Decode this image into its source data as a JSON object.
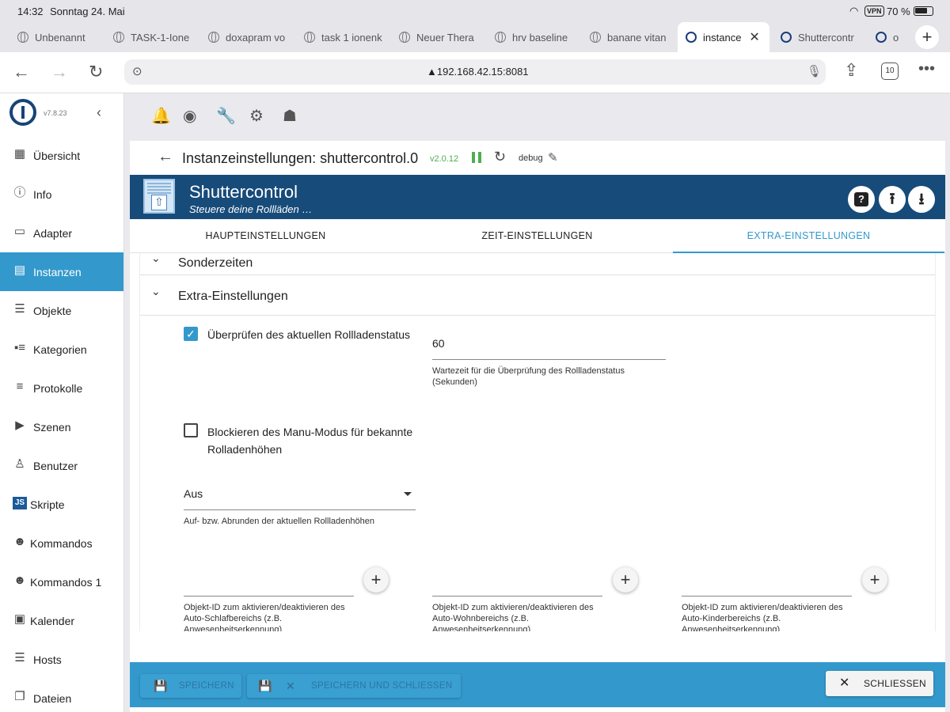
{
  "status_bar": {
    "time": "14:32",
    "date": "Sonntag 24. Mai",
    "vpn": "VPN",
    "battery": "70 %"
  },
  "browser_tabs": [
    {
      "label": "Unbenannt"
    },
    {
      "label": "TASK-1-Ione"
    },
    {
      "label": "doxapram vo"
    },
    {
      "label": "task 1 ionenk"
    },
    {
      "label": "Neuer Thera"
    },
    {
      "label": "hrv baseline"
    },
    {
      "label": "banane vitan"
    },
    {
      "label": "instance"
    },
    {
      "label": "Shuttercontr"
    },
    {
      "label": "o"
    }
  ],
  "address_bar": {
    "url": "▲192.168.42.15:8081",
    "tab_count": "10"
  },
  "sidebar": {
    "version": "v7.8.23",
    "items": [
      {
        "label": "Übersicht",
        "icon": "grid-icon"
      },
      {
        "label": "Info",
        "icon": "info-icon"
      },
      {
        "label": "Adapter",
        "icon": "store-icon"
      },
      {
        "label": "Instanzen",
        "icon": "instances-icon"
      },
      {
        "label": "Objekte",
        "icon": "list-icon"
      },
      {
        "label": "Kategorien",
        "icon": "categories-icon"
      },
      {
        "label": "Protokolle",
        "icon": "lines-icon"
      },
      {
        "label": "Szenen",
        "icon": "scenes-icon"
      },
      {
        "label": "Benutzer",
        "icon": "user-icon"
      },
      {
        "label": "Skripte",
        "icon": "js-icon"
      },
      {
        "label": "Kommandos",
        "icon": "person-icon"
      },
      {
        "label": "Kommandos 1",
        "icon": "person-icon"
      },
      {
        "label": "Kalender",
        "icon": "calendar-icon"
      },
      {
        "label": "Hosts",
        "icon": "hosts-icon"
      },
      {
        "label": "Dateien",
        "icon": "files-icon"
      }
    ]
  },
  "panel": {
    "title": "Instanzeinstellungen: shuttercontrol.0",
    "version": "v2.0.12",
    "log_level": "debug",
    "app_name": "Shuttercontrol",
    "app_subtitle": "Steuere deine Rollläden …",
    "tabs": [
      "HAUPTEINSTELLUNGEN",
      "ZEIT-EINSTELLUNGEN",
      "EXTRA-EINSTELLUNGEN"
    ],
    "active_tab": 2
  },
  "sections": {
    "sonderzeiten": "Sonderzeiten",
    "extra": "Extra-Einstellungen"
  },
  "fields": {
    "check_status_label": "Überprüfen des aktuellen Rollladenstatus",
    "check_status_checked": true,
    "wait_value": "60",
    "wait_helper": "Wartezeit für die Überprüfung des Rollladenstatus (Sekunden)",
    "block_manu_label": "Blockieren des Manu-Modus für bekannte Rolladenhöhen",
    "block_manu_checked": false,
    "rounding_value": "Aus",
    "rounding_helper": "Auf- bzw. Abrunden der aktuellen Rollladenhöhen",
    "sleep_helper": "Objekt-ID zum aktivieren/deaktivieren des Auto-Schlafbereichs (z.B. Anwesenheitserkennung)",
    "living_helper": "Objekt-ID zum aktivieren/deaktivieren des Auto-Wohnbereichs (z.B. Anwesenheitserkennung)",
    "children_helper": "Objekt-ID zum aktivieren/deaktivieren des Auto-Kinderbereichs (z.B. Anwesenheitserkennung)"
  },
  "bottom_bar": {
    "save": "SPEICHERN",
    "save_close": "SPEICHERN UND SCHLIESSEN",
    "close": "SCHLIESSEN"
  },
  "colors": {
    "accent": "#3399cc",
    "header": "#174b7a",
    "version_green": "#4caf50"
  }
}
